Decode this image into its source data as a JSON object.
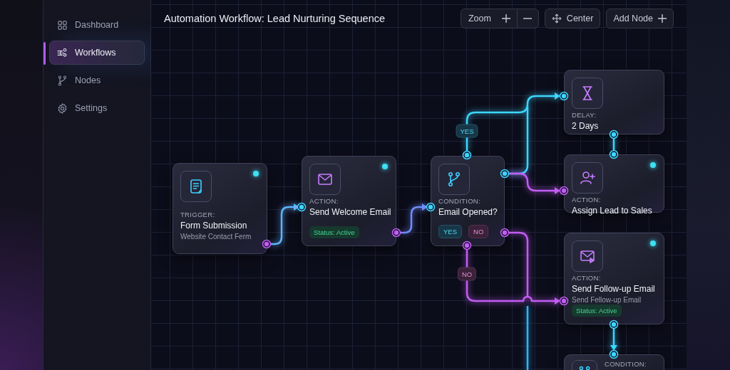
{
  "sidebar": {
    "items": [
      {
        "label": "Dashboard",
        "selected": false
      },
      {
        "label": "Workflows",
        "selected": true
      },
      {
        "label": "Nodes",
        "selected": false
      },
      {
        "label": "Settings",
        "selected": false
      }
    ]
  },
  "header": {
    "title": "Automation Workflow: Lead Nurturing Sequence",
    "zoom_label": "Zoom",
    "center_button": "Center",
    "add_node_button": "Add Node"
  },
  "canvas": {
    "nodes": [
      {
        "category": "TRIGGER:",
        "title": "Form Submission",
        "subtitle": "Website Contact Ferm",
        "indicator": true
      },
      {
        "category": "ACTION:",
        "title": "Send Welcome Email",
        "indicator": true,
        "badges": [
          {
            "kind": "status",
            "label": "Status: Active"
          }
        ]
      },
      {
        "category": "CONDITION:",
        "title": "Email Opened?",
        "indicator": false,
        "badges": [
          {
            "kind": "yes",
            "label": "YES"
          },
          {
            "kind": "no",
            "label": "NO"
          }
        ]
      },
      {
        "category": "DELAY:",
        "title": "2 Days",
        "indicator": false
      },
      {
        "category": "ACTION:",
        "title": "Assign Lead to Sales",
        "indicator": true
      },
      {
        "category": "ACTION:",
        "title": "Send Follow-up Email",
        "subtitle": "Send Fellow-up Email",
        "indicator": true,
        "badges": [
          {
            "kind": "status",
            "label": "Status: Active"
          }
        ]
      },
      {
        "category": "CONDITION:",
        "indicator": false
      }
    ],
    "edge_labels": [
      {
        "kind": "yes",
        "label": "YES"
      },
      {
        "kind": "no",
        "label": "NO"
      }
    ]
  }
}
